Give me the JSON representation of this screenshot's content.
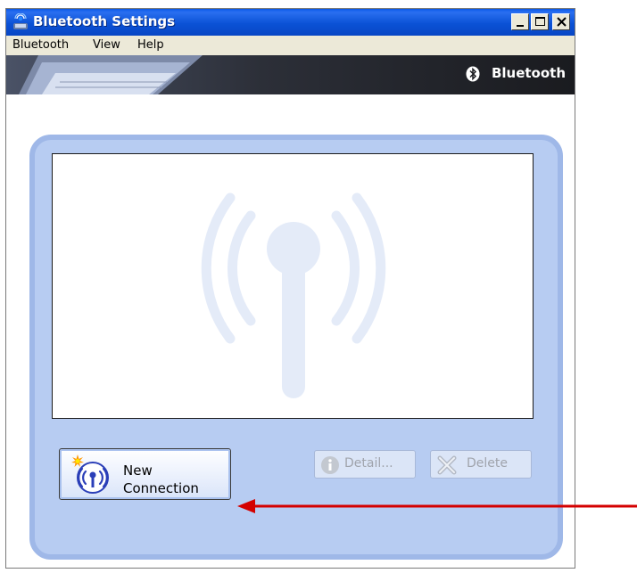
{
  "window": {
    "title": "Bluetooth Settings",
    "icons": {
      "app": "bluetooth-settings-app-icon",
      "minimize": "minimize-icon",
      "maximize": "maximize-icon",
      "close": "close-icon"
    }
  },
  "menu": {
    "items": [
      "Bluetooth",
      "View",
      "Help"
    ]
  },
  "banner": {
    "brand": "Bluetooth",
    "logo_icon": "bluetooth-logo-icon"
  },
  "listview": {
    "watermark_icon": "antenna-signal-icon",
    "items": []
  },
  "buttons": {
    "new_connection": {
      "line1": "New",
      "line2": "Connection",
      "icon": "new-connection-antenna-icon"
    },
    "detail": {
      "label": "Detail...",
      "icon": "info-icon",
      "enabled": false
    },
    "delete": {
      "label": "Delete",
      "icon": "delete-x-icon",
      "enabled": false
    }
  },
  "annotation": {
    "arrow_color": "#d40000"
  },
  "colors": {
    "titlebar": "#0b52d6",
    "panel": "#b7ccf2",
    "panel_border": "#9fb8e8"
  }
}
